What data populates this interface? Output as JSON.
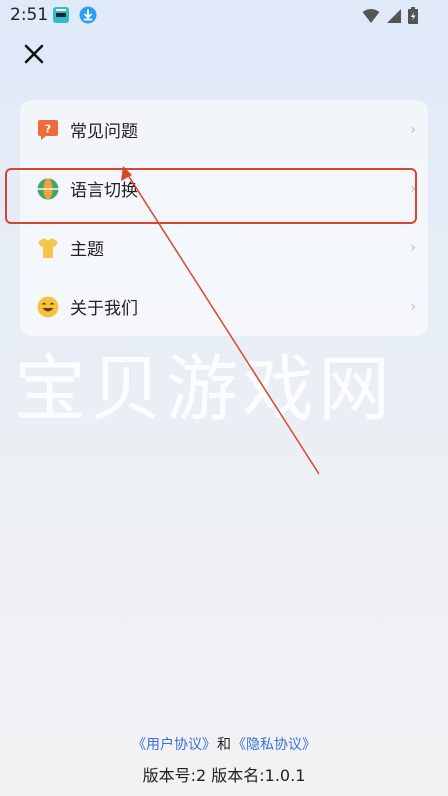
{
  "status_bar": {
    "time": "2:51"
  },
  "menu": {
    "items": [
      {
        "label": "常见问题",
        "icon": "question-icon"
      },
      {
        "label": "语言切换",
        "icon": "globe-icon"
      },
      {
        "label": "主题",
        "icon": "tshirt-icon"
      },
      {
        "label": "关于我们",
        "icon": "smile-icon"
      }
    ],
    "chevron": "›"
  },
  "watermark": "宝贝游戏网",
  "footer": {
    "user_agreement": "《用户协议》",
    "and": "和",
    "privacy_policy": "《隐私协议》",
    "version": "版本号:2 版本名:1.0.1"
  },
  "colors": {
    "highlight": "#d9472b",
    "link": "#3e6fd8"
  }
}
